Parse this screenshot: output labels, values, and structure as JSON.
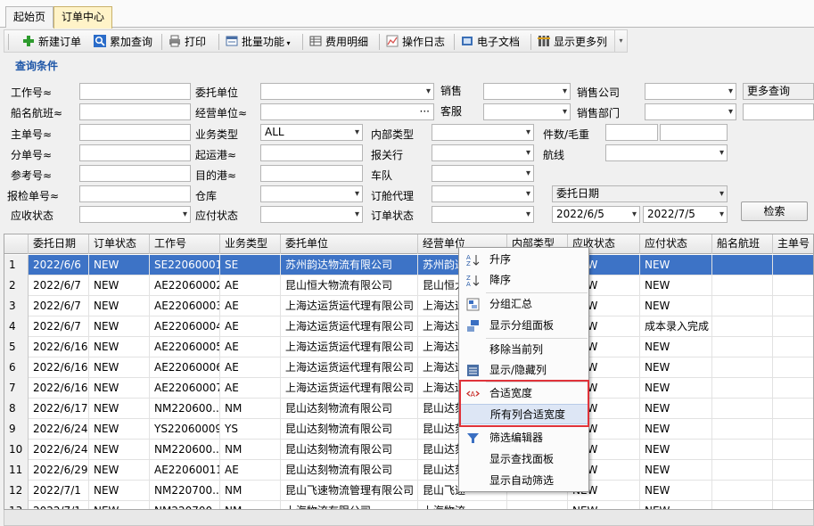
{
  "tabs": [
    {
      "label": "起始页"
    },
    {
      "label": "订单中心"
    }
  ],
  "toolbar": {
    "new_order": "新建订单",
    "add_query": "累加查询",
    "print": "打印",
    "batch": "批量功能",
    "fees": "费用明细",
    "log": "操作日志",
    "docs": "电子文档",
    "more_cols": "显示更多列"
  },
  "query": {
    "title": "查询条件",
    "job_no": "工作号≈",
    "vessel": "船名航班≈",
    "mbl": "主单号≈",
    "hbl": "分单号≈",
    "ref_no": "参考号≈",
    "insp_no": "报检单号≈",
    "recv_status": "应收状态",
    "client": "委托单位",
    "operator_unit": "经营单位≈",
    "biz_type": "业务类型",
    "biz_type_value": "ALL",
    "pol": "起运港≈",
    "pod": "目的港≈",
    "warehouse": "仓库",
    "pay_status": "应付状态",
    "sales": "销售",
    "cs": "客服",
    "internal_type": "内部类型",
    "customs": "报关行",
    "fleet": "车队",
    "booking_agent": "订舱代理",
    "order_status": "订单状态",
    "sales_company": "销售公司",
    "sales_dept": "销售部门",
    "pkg_weight": "件数/毛重",
    "route": "航线",
    "more_query": "更多查询",
    "date_type": "委托日期",
    "date_from": "2022/6/5",
    "date_to": "2022/7/5",
    "search": "检索",
    "ellipsis": "···"
  },
  "grid": {
    "columns": [
      "委托日期",
      "订单状态",
      "工作号",
      "业务类型",
      "委托单位",
      "经营单位",
      "内部类型",
      "应收状态",
      "应付状态",
      "船名航班",
      "主单号"
    ],
    "rows": [
      {
        "n": "1",
        "date": "2022/6/6",
        "status": "NEW",
        "job": "SE22060001",
        "type": "SE",
        "client": "苏州韵达物流有限公司",
        "op": "苏州韵达",
        "recv": "NEW",
        "pay": "NEW"
      },
      {
        "n": "2",
        "date": "2022/6/7",
        "status": "NEW",
        "job": "AE22060002",
        "type": "AE",
        "client": "昆山恒大物流有限公司",
        "op": "昆山恒大",
        "recv": "NEW",
        "pay": "NEW"
      },
      {
        "n": "3",
        "date": "2022/6/7",
        "status": "NEW",
        "job": "AE22060003",
        "type": "AE",
        "client": "上海达运货运代理有限公司",
        "op": "上海达运",
        "recv": "NEW",
        "pay": "NEW"
      },
      {
        "n": "4",
        "date": "2022/6/7",
        "status": "NEW",
        "job": "AE22060004",
        "type": "AE",
        "client": "上海达运货运代理有限公司",
        "op": "上海达运",
        "recv": "NEW",
        "pay": "成本录入完成"
      },
      {
        "n": "5",
        "date": "2022/6/16",
        "status": "NEW",
        "job": "AE22060005",
        "type": "AE",
        "client": "上海达运货运代理有限公司",
        "op": "上海达运",
        "recv": "NEW",
        "pay": "NEW"
      },
      {
        "n": "6",
        "date": "2022/6/16",
        "status": "NEW",
        "job": "AE22060006",
        "type": "AE",
        "client": "上海达运货运代理有限公司",
        "op": "上海达运",
        "recv": "NEW",
        "pay": "NEW"
      },
      {
        "n": "7",
        "date": "2022/6/16",
        "status": "NEW",
        "job": "AE22060007",
        "type": "AE",
        "client": "上海达运货运代理有限公司",
        "op": "上海达运",
        "recv": "NEW",
        "pay": "NEW"
      },
      {
        "n": "8",
        "date": "2022/6/17",
        "status": "NEW",
        "job": "NM220600...",
        "type": "NM",
        "client": "昆山达刻物流有限公司",
        "op": "昆山达刻",
        "recv": "NEW",
        "pay": "NEW"
      },
      {
        "n": "9",
        "date": "2022/6/24",
        "status": "NEW",
        "job": "YS22060009",
        "type": "YS",
        "client": "昆山达刻物流有限公司",
        "op": "昆山达刻",
        "recv": "NEW",
        "pay": "NEW"
      },
      {
        "n": "10",
        "date": "2022/6/24",
        "status": "NEW",
        "job": "NM220600...",
        "type": "NM",
        "client": "昆山达刻物流有限公司",
        "op": "昆山达刻",
        "recv": "NEW",
        "pay": "NEW"
      },
      {
        "n": "11",
        "date": "2022/6/29",
        "status": "NEW",
        "job": "AE22060011",
        "type": "AE",
        "client": "昆山达刻物流有限公司",
        "op": "昆山达刻",
        "recv": "NEW",
        "pay": "NEW"
      },
      {
        "n": "12",
        "date": "2022/7/1",
        "status": "NEW",
        "job": "NM220700...",
        "type": "NM",
        "client": "昆山飞速物流管理有限公司",
        "op": "昆山飞速",
        "recv": "NEW",
        "pay": "NEW"
      },
      {
        "n": "13",
        "date": "2022/7/1",
        "status": "NEW",
        "job": "NM220700...",
        "type": "NM",
        "client": "上海物流有限公司",
        "op": "上海物流",
        "recv": "NEW",
        "pay": "NEW"
      }
    ]
  },
  "context_menu": {
    "asc": "升序",
    "desc": "降序",
    "group_summary": "分组汇总",
    "show_group_panel": "显示分组面板",
    "remove_column": "移除当前列",
    "toggle_columns": "显示/隐藏列",
    "best_fit": "合适宽度",
    "best_fit_all": "所有列合适宽度",
    "filter_editor": "筛选编辑器",
    "show_find_panel": "显示查找面板",
    "show_auto_filter": "显示自动筛选"
  },
  "colors": {
    "selected_row": "#3d73c6",
    "section_title": "#1f57a8",
    "highlight_box": "#e0333a",
    "active_tab": "#fff3c8"
  }
}
